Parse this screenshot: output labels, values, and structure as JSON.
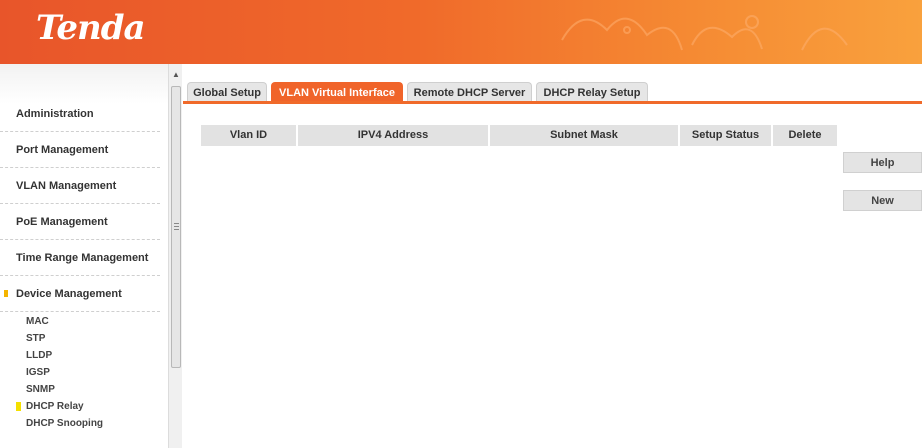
{
  "header": {
    "logo": "Tenda",
    "accent_color": "#f06a2a"
  },
  "sidebar": {
    "items": [
      {
        "label": "Administration"
      },
      {
        "label": "Port Management"
      },
      {
        "label": "VLAN Management"
      },
      {
        "label": "PoE Management"
      },
      {
        "label": "Time Range Management"
      },
      {
        "label": "Device Management"
      }
    ],
    "subitems": [
      {
        "label": "MAC"
      },
      {
        "label": "STP"
      },
      {
        "label": "LLDP"
      },
      {
        "label": "IGSP"
      },
      {
        "label": "SNMP"
      },
      {
        "label": "DHCP Relay"
      },
      {
        "label": "DHCP Snooping"
      }
    ],
    "active_subitem": "DHCP Relay"
  },
  "tabs": [
    {
      "label": "Global Setup"
    },
    {
      "label": "VLAN Virtual Interface"
    },
    {
      "label": "Remote DHCP Server"
    },
    {
      "label": "DHCP Relay Setup"
    }
  ],
  "active_tab": "VLAN Virtual Interface",
  "table": {
    "columns": [
      "Vlan ID",
      "IPV4 Address",
      "Subnet Mask",
      "Setup Status",
      "Delete"
    ],
    "rows": []
  },
  "buttons": {
    "help": "Help",
    "new": "New"
  }
}
